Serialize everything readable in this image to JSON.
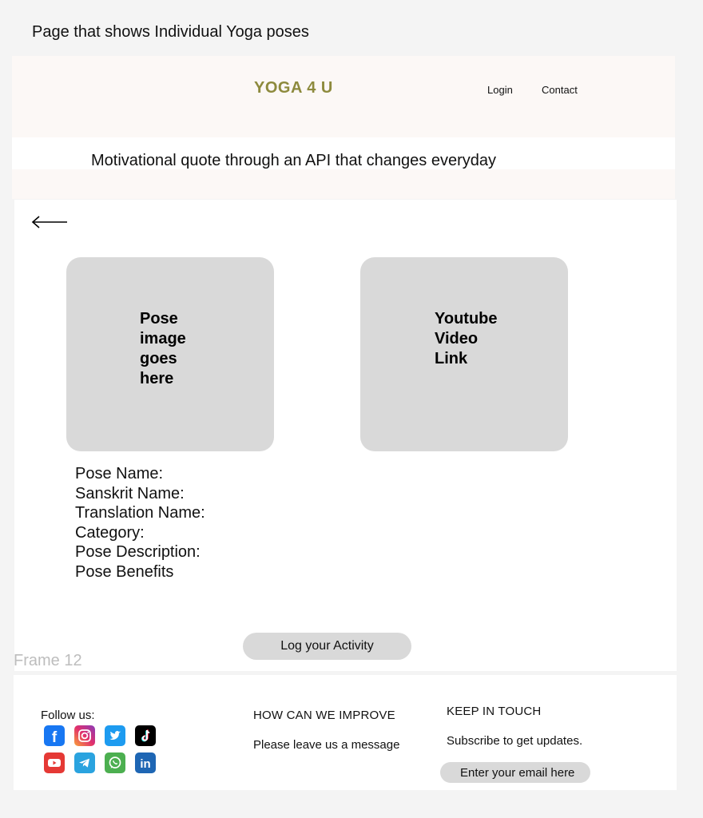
{
  "caption": "Page that shows Individual Yoga poses",
  "header": {
    "brand": "YOGA 4 U",
    "nav": {
      "login": "Login",
      "contact": "Contact"
    }
  },
  "quote": "Motivational quote through an API that changes everyday",
  "cards": {
    "image": "Pose image goes here",
    "video": "Youtube Video Link"
  },
  "details": [
    "Pose Name:",
    "Sanskrit Name:",
    "Translation Name:",
    "Category:",
    "Pose Description:",
    "Pose Benefits"
  ],
  "log_button": "Log your Activity",
  "frame_label": "Frame 12",
  "footer": {
    "follow_label": "Follow us:",
    "social_icons": [
      "facebook-icon",
      "instagram-icon",
      "twitter-icon",
      "tiktok-icon",
      "youtube-icon",
      "telegram-icon",
      "whatsapp-icon",
      "linkedin-icon"
    ],
    "improve_title": "HOW CAN WE IMPROVE",
    "improve_sub": "Please leave us a message",
    "keep_title": "KEEP IN TOUCH",
    "keep_sub": "Subscribe to get updates.",
    "email_placeholder": "Enter your email here"
  },
  "colors": {
    "brand": "#8d8a3d",
    "header_bg": "#fcf8f6",
    "placeholder_gray": "#d9d9d9"
  }
}
